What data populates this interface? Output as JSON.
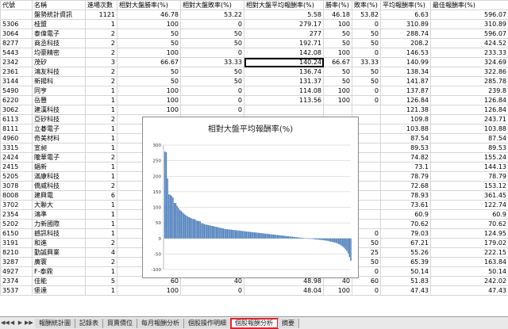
{
  "sheet": {
    "headers": [
      "代號",
      "名稱",
      "進場次數",
      "相對大盤勝率(%)",
      "相對大盤敗率(%)",
      "相對大盤平均報酬率(%)",
      "勝率(%)",
      "敗率(%)",
      "平均報酬率(%)",
      "最佳報酬率(%)"
    ],
    "rows": [
      [
        "",
        "盤勢統計資訊",
        "1121",
        "46.78",
        "53.22",
        "5.58",
        "46.18",
        "53.82",
        "6.63",
        "596.07"
      ],
      [
        "5306",
        "桂盟",
        "1",
        "100",
        "0",
        "279.17",
        "100",
        "0",
        "310.89",
        "310.89"
      ],
      [
        "3064",
        "泰偉電子",
        "2",
        "50",
        "50",
        "277",
        "50",
        "50",
        "288.74",
        "596.07"
      ],
      [
        "8277",
        "商丞科技",
        "2",
        "50",
        "50",
        "192.71",
        "50",
        "50",
        "208.2",
        "424.52"
      ],
      [
        "5443",
        "均豪精密",
        "2",
        "100",
        "0",
        "142.08",
        "100",
        "0",
        "146.53",
        "233.33"
      ],
      [
        "2342",
        "茂矽",
        "3",
        "66.67",
        "33.33",
        "140.24",
        "66.67",
        "33.33",
        "140.99",
        "324.69"
      ],
      [
        "2361",
        "鴻友科技",
        "2",
        "50",
        "50",
        "136.74",
        "50",
        "50",
        "138.34",
        "322.86"
      ],
      [
        "3144",
        "新揚科",
        "2",
        "50",
        "50",
        "131.37",
        "50",
        "50",
        "141.87",
        "285.78"
      ],
      [
        "5490",
        "同亨",
        "1",
        "100",
        "0",
        "114.08",
        "100",
        "0",
        "137.87",
        "239.8"
      ],
      [
        "6220",
        "岳豐",
        "1",
        "100",
        "0",
        "113.56",
        "100",
        "0",
        "126.84",
        "126.84"
      ],
      [
        "3062",
        "建漢科技",
        "1",
        "100",
        "0",
        "",
        "",
        "",
        "121.38",
        "126.84"
      ],
      [
        "6113",
        "亞矽科技",
        "2",
        "50",
        "50",
        "",
        "",
        "",
        "109.8",
        "243.71"
      ],
      [
        "8111",
        "立碁電子",
        "1",
        "100",
        "0",
        "",
        "",
        "",
        "103.88",
        "103.88"
      ],
      [
        "4960",
        "奇美材料",
        "1",
        "100",
        "0",
        "",
        "",
        "",
        "87.54",
        "87.54"
      ],
      [
        "3315",
        "宣昶",
        "1",
        "100",
        "0",
        "",
        "",
        "",
        "89.53",
        "89.53"
      ],
      [
        "2424",
        "隴華電子",
        "2",
        "50",
        "50",
        "",
        "",
        "",
        "74.82",
        "155.24"
      ],
      [
        "2415",
        "錩新",
        "1",
        "100",
        "0",
        "",
        "",
        "",
        "73.1",
        "144.13"
      ],
      [
        "5205",
        "滿康科技",
        "1",
        "100",
        "0",
        "",
        "",
        "",
        "78.79",
        "78.79"
      ],
      [
        "3078",
        "僑威科技",
        "2",
        "50",
        "50",
        "",
        "",
        "",
        "72.68",
        "153.12"
      ],
      [
        "8008",
        "建興電",
        "6",
        "66.67",
        "33.33",
        "",
        "",
        "",
        "78.93",
        "361.45"
      ],
      [
        "3702",
        "大聯大",
        "1",
        "100",
        "0",
        "",
        "",
        "",
        "73.61",
        "122.74"
      ],
      [
        "2354",
        "鴻準",
        "1",
        "100",
        "0",
        "",
        "",
        "",
        "60.9",
        "60.9"
      ],
      [
        "5202",
        "力新國際",
        "1",
        "100",
        "0",
        "",
        "",
        "",
        "70.62",
        "70.62"
      ],
      [
        "6150",
        "撼訊科技",
        "1",
        "100",
        "0",
        "61.99",
        "100",
        "0",
        "79.03",
        "124.95"
      ],
      [
        "3191",
        "和進",
        "2",
        "50",
        "50",
        "58.44",
        "50",
        "50",
        "67.21",
        "179.02"
      ],
      [
        "8210",
        "勤誠興業",
        "4",
        "75",
        "25",
        "56.74",
        "75",
        "25",
        "55.26",
        "222.15"
      ],
      [
        "3287",
        "廣寰",
        "2",
        "50",
        "50",
        "55.55",
        "50",
        "50",
        "65.39",
        "163.84"
      ],
      [
        "4927",
        "F-泰鼎",
        "1",
        "100",
        "0",
        "54.86",
        "100",
        "0",
        "50.14",
        "50.14"
      ],
      [
        "2374",
        "佳能",
        "5",
        "60",
        "40",
        "48.98",
        "40",
        "60",
        "51.83",
        "242.02"
      ],
      [
        "3537",
        "堡達",
        "1",
        "100",
        "0",
        "48.04",
        "100",
        "0",
        "47.43",
        "47.43"
      ]
    ]
  },
  "chart_data": {
    "type": "bar",
    "title": "相對大盤平均報酬率(%)",
    "ylim": [
      -100,
      300
    ],
    "yticks": [
      "300",
      "250",
      "200",
      "150",
      "100",
      "50",
      "0",
      "-50",
      "-100"
    ],
    "grid": true,
    "values": [
      279.17,
      277,
      192.71,
      142.08,
      140.24,
      136.74,
      131.37,
      114.08,
      113.56,
      105,
      98,
      92,
      88,
      84,
      80,
      76,
      73,
      70,
      68,
      66,
      64,
      62,
      61.99,
      58.44,
      56.74,
      55.55,
      54.86,
      48.98,
      48.04,
      46,
      45,
      44,
      43,
      42,
      41,
      40,
      39,
      38,
      37,
      36,
      35,
      34,
      33,
      32,
      31,
      30,
      29.5,
      29,
      28.5,
      28,
      27.5,
      27,
      26.5,
      26,
      25.5,
      25,
      24.5,
      24,
      23.5,
      23,
      22.5,
      22,
      21.5,
      21,
      20.5,
      20,
      19.5,
      19,
      18.5,
      18,
      17.5,
      17,
      16.5,
      16,
      15.5,
      15,
      14.5,
      14,
      13.5,
      13,
      12.5,
      12,
      11.5,
      11,
      10.5,
      10,
      9.5,
      9,
      8.5,
      8,
      7.5,
      7,
      6.5,
      6,
      5.5,
      5,
      4.5,
      4,
      3.5,
      3,
      2.5,
      2,
      1.5,
      1,
      0.5,
      0,
      -0.5,
      -1,
      -1.5,
      -2,
      -2.5,
      -3,
      -3.5,
      -4,
      -4.5,
      -5,
      -5.5,
      -6,
      -6.5,
      -7,
      -8,
      -9,
      -10,
      -11,
      -12,
      -13,
      -14,
      -16,
      -18,
      -20,
      -23,
      -26,
      -30,
      -35,
      -40,
      -48,
      -60,
      -72
    ]
  },
  "tabs": [
    "報酬統計圖",
    "記錄表",
    "買賣價位",
    "每月報酬分析",
    "個股操作明細",
    "個股報酬分析",
    "摘要"
  ],
  "active_tab": 5
}
